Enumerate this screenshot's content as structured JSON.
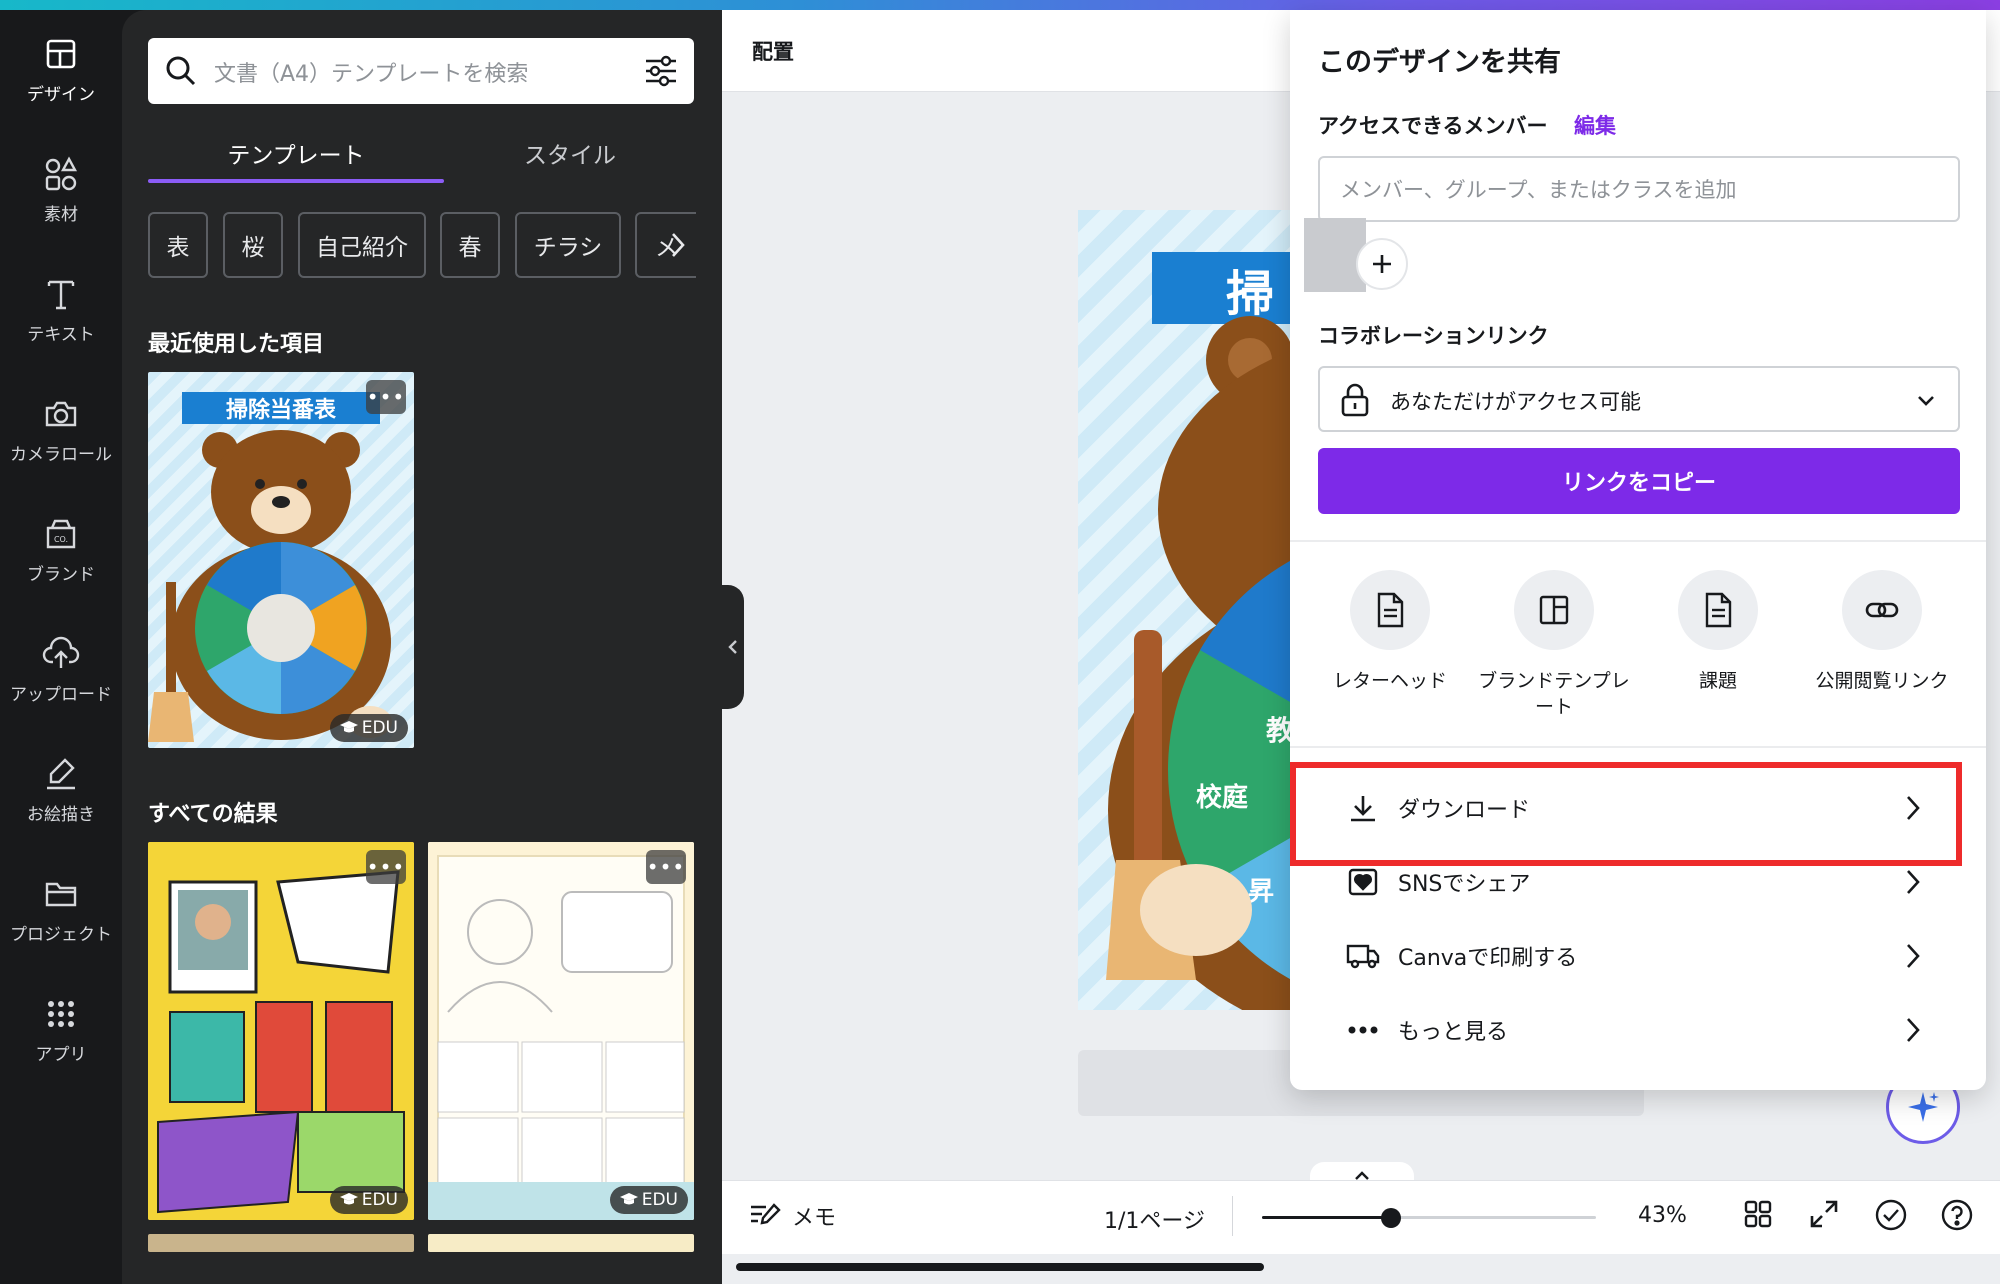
{
  "rail": {
    "items": [
      {
        "label": "デザイン",
        "icon": "layout-icon"
      },
      {
        "label": "素材",
        "icon": "elements-icon"
      },
      {
        "label": "テキスト",
        "icon": "text-icon"
      },
      {
        "label": "カメラロール",
        "icon": "camera-icon"
      },
      {
        "label": "ブランド",
        "icon": "brand-icon"
      },
      {
        "label": "アップロード",
        "icon": "upload-icon"
      },
      {
        "label": "お絵描き",
        "icon": "draw-icon"
      },
      {
        "label": "プロジェクト",
        "icon": "folder-icon"
      },
      {
        "label": "アプリ",
        "icon": "apps-icon"
      }
    ]
  },
  "panel": {
    "search_placeholder": "文書（A4）テンプレートを検索",
    "tabs": [
      "テンプレート",
      "スタイル"
    ],
    "chips": [
      "表",
      "桜",
      "自己紹介",
      "春",
      "チラシ",
      "メ"
    ],
    "recent_title": "最近使用した項目",
    "all_results_title": "すべての結果",
    "edu_badge": "EDU",
    "more": "•••",
    "thumb_recent_title": "掃除当番表"
  },
  "toolbar": {
    "label": "配置"
  },
  "share": {
    "title": "このデザインを共有",
    "access_members": "アクセスできるメンバー",
    "edit": "編集",
    "member_placeholder": "メンバー、グループ、またはクラスを追加",
    "collab_link": "コラボレーションリンク",
    "access_value": "あなただけがアクセス可能",
    "copy_link": "リンクをコピー",
    "options": [
      {
        "label": "レターヘッド",
        "icon": "document-icon"
      },
      {
        "label": "ブランドテンプレート",
        "icon": "template-icon"
      },
      {
        "label": "課題",
        "icon": "assignment-icon"
      },
      {
        "label": "公開閲覧リンク",
        "icon": "link-icon"
      }
    ],
    "rows": [
      {
        "label": "ダウンロード",
        "icon": "download-icon"
      },
      {
        "label": "SNSでシェア",
        "icon": "heart-icon"
      },
      {
        "label": "Canvaで印刷する",
        "icon": "truck-icon"
      },
      {
        "label": "もっと見る",
        "icon": "more-icon"
      }
    ]
  },
  "bottombar": {
    "memo": "メモ",
    "page": "1/1ページ",
    "zoom": "43%",
    "zoom_level": 0.43
  },
  "colors": {
    "accent": "#7d2ae8",
    "highlight": "#ee2b2b",
    "rail_bg": "#18191b",
    "panel_bg": "#252627"
  }
}
